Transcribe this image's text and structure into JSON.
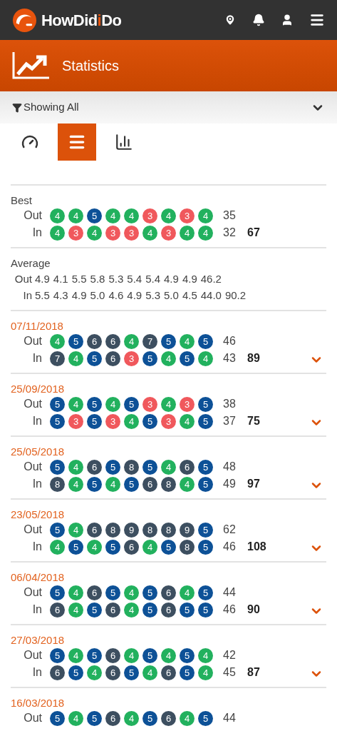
{
  "app_bar": {
    "logo": [
      {
        "text": "HowDid",
        "accent": false
      },
      {
        "text": "i",
        "accent": true
      },
      {
        "text": "Do",
        "accent": false
      }
    ]
  },
  "page_header": {
    "title": "Statistics"
  },
  "filter": {
    "label": "Showing All",
    "expanded": false
  },
  "view_tabs": [
    {
      "kind": "dashboard",
      "selected": false
    },
    {
      "kind": "list",
      "selected": true
    },
    {
      "kind": "chart",
      "selected": false
    }
  ],
  "best": {
    "title": "Best",
    "out": {
      "label": "Out",
      "scores": [
        {
          "score": "4",
          "color": "#22b15e"
        },
        {
          "score": "4",
          "color": "#22b15e"
        },
        {
          "score": "5",
          "color": "#0d5197"
        },
        {
          "score": "4",
          "color": "#22b15e"
        },
        {
          "score": "4",
          "color": "#22b15e"
        },
        {
          "score": "3",
          "color": "#f0585c"
        },
        {
          "score": "4",
          "color": "#22b15e"
        },
        {
          "score": "3",
          "color": "#f0585c"
        },
        {
          "score": "4",
          "color": "#22b15e"
        }
      ],
      "total": "35"
    },
    "in": {
      "label": "In",
      "scores": [
        {
          "score": "4",
          "color": "#22b15e"
        },
        {
          "score": "3",
          "color": "#f0585c"
        },
        {
          "score": "4",
          "color": "#22b15e"
        },
        {
          "score": "3",
          "color": "#f0585c"
        },
        {
          "score": "3",
          "color": "#f0585c"
        },
        {
          "score": "4",
          "color": "#22b15e"
        },
        {
          "score": "3",
          "color": "#f0585c"
        },
        {
          "score": "4",
          "color": "#22b15e"
        },
        {
          "score": "4",
          "color": "#22b15e"
        }
      ],
      "total": "32"
    },
    "grand_total": "67"
  },
  "average": {
    "title": "Average",
    "out": {
      "label": "Out",
      "values": [
        "4.9",
        "4.1",
        "5.5",
        "5.8",
        "5.3",
        "5.4",
        "5.4",
        "4.9",
        "4.9",
        "46.2"
      ]
    },
    "in": {
      "label": "In",
      "values": [
        "5.5",
        "4.3",
        "4.9",
        "5.0",
        "4.6",
        "4.9",
        "5.3",
        "5.0",
        "4.5",
        "44.0",
        "90.2"
      ]
    }
  },
  "rounds": [
    {
      "date": "07/11/2018",
      "expanded": false,
      "out": {
        "label": "Out",
        "scores": [
          {
            "score": "4",
            "color": "#22b15e"
          },
          {
            "score": "5",
            "color": "#0d5197"
          },
          {
            "score": "6",
            "color": "#3d4f60"
          },
          {
            "score": "6",
            "color": "#3d4f60"
          },
          {
            "score": "4",
            "color": "#22b15e"
          },
          {
            "score": "7",
            "color": "#3d4f60"
          },
          {
            "score": "5",
            "color": "#0d5197"
          },
          {
            "score": "4",
            "color": "#22b15e"
          },
          {
            "score": "5",
            "color": "#0d5197"
          }
        ],
        "total": "46"
      },
      "in": {
        "label": "In",
        "scores": [
          {
            "score": "7",
            "color": "#3d4f60"
          },
          {
            "score": "4",
            "color": "#22b15e"
          },
          {
            "score": "5",
            "color": "#0d5197"
          },
          {
            "score": "6",
            "color": "#3d4f60"
          },
          {
            "score": "3",
            "color": "#f0585c"
          },
          {
            "score": "5",
            "color": "#0d5197"
          },
          {
            "score": "4",
            "color": "#22b15e"
          },
          {
            "score": "5",
            "color": "#0d5197"
          },
          {
            "score": "4",
            "color": "#22b15e"
          }
        ],
        "total": "43"
      },
      "grand_total": "89"
    },
    {
      "date": "25/09/2018",
      "expanded": false,
      "out": {
        "label": "Out",
        "scores": [
          {
            "score": "5",
            "color": "#0d5197"
          },
          {
            "score": "4",
            "color": "#22b15e"
          },
          {
            "score": "5",
            "color": "#0d5197"
          },
          {
            "score": "4",
            "color": "#22b15e"
          },
          {
            "score": "5",
            "color": "#0d5197"
          },
          {
            "score": "3",
            "color": "#f0585c"
          },
          {
            "score": "4",
            "color": "#22b15e"
          },
          {
            "score": "3",
            "color": "#f0585c"
          },
          {
            "score": "5",
            "color": "#0d5197"
          }
        ],
        "total": "38"
      },
      "in": {
        "label": "In",
        "scores": [
          {
            "score": "5",
            "color": "#0d5197"
          },
          {
            "score": "3",
            "color": "#f0585c"
          },
          {
            "score": "5",
            "color": "#0d5197"
          },
          {
            "score": "3",
            "color": "#f0585c"
          },
          {
            "score": "4",
            "color": "#22b15e"
          },
          {
            "score": "5",
            "color": "#0d5197"
          },
          {
            "score": "3",
            "color": "#f0585c"
          },
          {
            "score": "4",
            "color": "#22b15e"
          },
          {
            "score": "5",
            "color": "#0d5197"
          }
        ],
        "total": "37"
      },
      "grand_total": "75"
    },
    {
      "date": "25/05/2018",
      "expanded": false,
      "out": {
        "label": "Out",
        "scores": [
          {
            "score": "5",
            "color": "#0d5197"
          },
          {
            "score": "4",
            "color": "#22b15e"
          },
          {
            "score": "6",
            "color": "#3d4f60"
          },
          {
            "score": "5",
            "color": "#0d5197"
          },
          {
            "score": "8",
            "color": "#3d4f60"
          },
          {
            "score": "5",
            "color": "#0d5197"
          },
          {
            "score": "4",
            "color": "#22b15e"
          },
          {
            "score": "6",
            "color": "#3d4f60"
          },
          {
            "score": "5",
            "color": "#0d5197"
          }
        ],
        "total": "48"
      },
      "in": {
        "label": "In",
        "scores": [
          {
            "score": "8",
            "color": "#3d4f60"
          },
          {
            "score": "4",
            "color": "#22b15e"
          },
          {
            "score": "5",
            "color": "#0d5197"
          },
          {
            "score": "4",
            "color": "#22b15e"
          },
          {
            "score": "5",
            "color": "#0d5197"
          },
          {
            "score": "6",
            "color": "#3d4f60"
          },
          {
            "score": "8",
            "color": "#3d4f60"
          },
          {
            "score": "4",
            "color": "#22b15e"
          },
          {
            "score": "5",
            "color": "#0d5197"
          }
        ],
        "total": "49"
      },
      "grand_total": "97"
    },
    {
      "date": "23/05/2018",
      "expanded": false,
      "out": {
        "label": "Out",
        "scores": [
          {
            "score": "5",
            "color": "#0d5197"
          },
          {
            "score": "4",
            "color": "#22b15e"
          },
          {
            "score": "6",
            "color": "#3d4f60"
          },
          {
            "score": "8",
            "color": "#3d4f60"
          },
          {
            "score": "9",
            "color": "#3d4f60"
          },
          {
            "score": "8",
            "color": "#3d4f60"
          },
          {
            "score": "8",
            "color": "#3d4f60"
          },
          {
            "score": "9",
            "color": "#3d4f60"
          },
          {
            "score": "5",
            "color": "#0d5197"
          }
        ],
        "total": "62"
      },
      "in": {
        "label": "In",
        "scores": [
          {
            "score": "4",
            "color": "#22b15e"
          },
          {
            "score": "5",
            "color": "#0d5197"
          },
          {
            "score": "4",
            "color": "#22b15e"
          },
          {
            "score": "5",
            "color": "#0d5197"
          },
          {
            "score": "6",
            "color": "#3d4f60"
          },
          {
            "score": "4",
            "color": "#22b15e"
          },
          {
            "score": "5",
            "color": "#0d5197"
          },
          {
            "score": "8",
            "color": "#3d4f60"
          },
          {
            "score": "5",
            "color": "#0d5197"
          }
        ],
        "total": "46"
      },
      "grand_total": "108"
    },
    {
      "date": "06/04/2018",
      "expanded": false,
      "out": {
        "label": "Out",
        "scores": [
          {
            "score": "5",
            "color": "#0d5197"
          },
          {
            "score": "4",
            "color": "#22b15e"
          },
          {
            "score": "6",
            "color": "#3d4f60"
          },
          {
            "score": "5",
            "color": "#0d5197"
          },
          {
            "score": "4",
            "color": "#22b15e"
          },
          {
            "score": "5",
            "color": "#0d5197"
          },
          {
            "score": "6",
            "color": "#3d4f60"
          },
          {
            "score": "4",
            "color": "#22b15e"
          },
          {
            "score": "5",
            "color": "#0d5197"
          }
        ],
        "total": "44"
      },
      "in": {
        "label": "In",
        "scores": [
          {
            "score": "6",
            "color": "#3d4f60"
          },
          {
            "score": "4",
            "color": "#22b15e"
          },
          {
            "score": "5",
            "color": "#0d5197"
          },
          {
            "score": "6",
            "color": "#3d4f60"
          },
          {
            "score": "4",
            "color": "#22b15e"
          },
          {
            "score": "5",
            "color": "#0d5197"
          },
          {
            "score": "6",
            "color": "#3d4f60"
          },
          {
            "score": "5",
            "color": "#0d5197"
          },
          {
            "score": "5",
            "color": "#0d5197"
          }
        ],
        "total": "46"
      },
      "grand_total": "90"
    },
    {
      "date": "27/03/2018",
      "expanded": false,
      "out": {
        "label": "Out",
        "scores": [
          {
            "score": "5",
            "color": "#0d5197"
          },
          {
            "score": "4",
            "color": "#22b15e"
          },
          {
            "score": "5",
            "color": "#0d5197"
          },
          {
            "score": "6",
            "color": "#3d4f60"
          },
          {
            "score": "4",
            "color": "#22b15e"
          },
          {
            "score": "5",
            "color": "#0d5197"
          },
          {
            "score": "4",
            "color": "#22b15e"
          },
          {
            "score": "5",
            "color": "#0d5197"
          },
          {
            "score": "4",
            "color": "#22b15e"
          }
        ],
        "total": "42"
      },
      "in": {
        "label": "In",
        "scores": [
          {
            "score": "6",
            "color": "#3d4f60"
          },
          {
            "score": "5",
            "color": "#0d5197"
          },
          {
            "score": "4",
            "color": "#22b15e"
          },
          {
            "score": "6",
            "color": "#3d4f60"
          },
          {
            "score": "5",
            "color": "#0d5197"
          },
          {
            "score": "4",
            "color": "#22b15e"
          },
          {
            "score": "6",
            "color": "#3d4f60"
          },
          {
            "score": "5",
            "color": "#0d5197"
          },
          {
            "score": "4",
            "color": "#22b15e"
          }
        ],
        "total": "45"
      },
      "grand_total": "87"
    },
    {
      "date": "16/03/2018",
      "out": {
        "label": "Out",
        "scores": [
          {
            "score": "5",
            "color": "#0d5197"
          },
          {
            "score": "4",
            "color": "#22b15e"
          },
          {
            "score": "5",
            "color": "#0d5197"
          },
          {
            "score": "6",
            "color": "#3d4f60"
          },
          {
            "score": "4",
            "color": "#22b15e"
          },
          {
            "score": "5",
            "color": "#0d5197"
          },
          {
            "score": "6",
            "color": "#3d4f60"
          },
          {
            "score": "4",
            "color": "#22b15e"
          },
          {
            "score": "5",
            "color": "#0d5197"
          }
        ],
        "total": "44"
      }
    }
  ]
}
